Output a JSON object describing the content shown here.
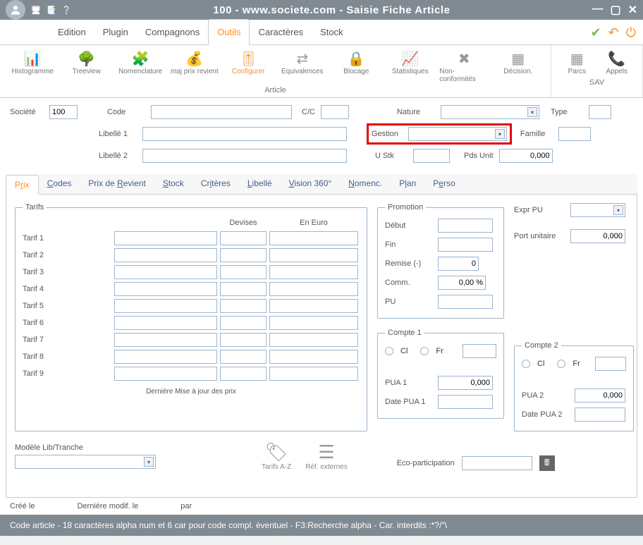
{
  "window": {
    "title": "100 - www.societe.com - Saisie Fiche Article"
  },
  "menubar": {
    "items": [
      "Edition",
      "Plugin",
      "Compagnons",
      "Outils",
      "Caractères",
      "Stock"
    ],
    "activeIndex": 3
  },
  "ribbon": {
    "group_article": {
      "label": "Article",
      "items": [
        {
          "label": "Histogramme"
        },
        {
          "label": "Treeview"
        },
        {
          "label": "Nomenclature"
        },
        {
          "label": "maj prix revient"
        },
        {
          "label": "Configurer",
          "active": true
        },
        {
          "label": "Equivalences"
        },
        {
          "label": "Blocage"
        },
        {
          "label": "Statistiques"
        },
        {
          "label": "Non-conformités"
        },
        {
          "label": "Décision."
        }
      ]
    },
    "group_sav": {
      "label": "SAV",
      "items": [
        {
          "label": "Parcs"
        },
        {
          "label": "Appels"
        }
      ]
    }
  },
  "header_form": {
    "societe_label": "Société",
    "societe_value": "100",
    "code_label": "Code",
    "code_value": "",
    "cc_label": "C/C",
    "cc_value": "",
    "nature_label": "Nature",
    "nature_value": "",
    "type_label": "Type",
    "type_value": "",
    "libelle1_label": "Libellé 1",
    "libelle1_value": "",
    "gestion_label": "Gestion",
    "gestion_value": "",
    "famille_label": "Famille",
    "famille_value": "",
    "libelle2_label": "Libellé 2",
    "libelle2_value": "",
    "ustk_label": "U Stk",
    "ustk_value": "",
    "pdsunit_label": "Pds Unit",
    "pdsunit_value": "0,000"
  },
  "tabs": {
    "items": [
      {
        "pre": "P",
        "u": "r",
        "post": "ix"
      },
      {
        "pre": "",
        "u": "C",
        "post": "odes"
      },
      {
        "pre": "Prix de ",
        "u": "R",
        "post": "evient"
      },
      {
        "pre": "",
        "u": "S",
        "post": "tock"
      },
      {
        "pre": "Cr",
        "u": "i",
        "post": "tères"
      },
      {
        "pre": "",
        "u": "L",
        "post": "ibellé"
      },
      {
        "pre": "",
        "u": "V",
        "post": "ision 360°"
      },
      {
        "pre": "",
        "u": "N",
        "post": "omenc."
      },
      {
        "pre": "P",
        "u": "l",
        "post": "an"
      },
      {
        "pre": "P",
        "u": "e",
        "post": "rso"
      }
    ],
    "activeIndex": 0
  },
  "tarifs": {
    "legend": "Tarifs",
    "col_devises": "Devises",
    "col_euro": "En Euro",
    "rows": [
      {
        "label": "Tarif 1"
      },
      {
        "label": "Tarif 2"
      },
      {
        "label": "Tarif 3"
      },
      {
        "label": "Tarif 4"
      },
      {
        "label": "Tarif 5"
      },
      {
        "label": "Tarif 6"
      },
      {
        "label": "Tarif 7"
      },
      {
        "label": "Tarif 8"
      },
      {
        "label": "Tarif 9"
      }
    ],
    "footer": "Dernière Mise à jour des prix"
  },
  "promotion": {
    "legend": "Promotion",
    "debut_label": "Début",
    "debut_value": "",
    "fin_label": "Fin",
    "fin_value": "",
    "remise_label": "Remise (-)",
    "remise_value": "0",
    "comm_label": "Comm.",
    "comm_value": "0,00 %",
    "pu_label": "PU",
    "pu_value": ""
  },
  "expr": {
    "exprpu_label": "Expr PU",
    "exprpu_value": "",
    "port_label": "Port unitaire",
    "port_value": "0,000"
  },
  "compte1": {
    "legend": "Compte 1",
    "cl_label": "Cl",
    "fr_label": "Fr",
    "value": "",
    "pua_label": "PUA 1",
    "pua_value": "0,000",
    "date_label": "Date PUA 1",
    "date_value": ""
  },
  "compte2": {
    "legend": "Compte 2",
    "cl_label": "Cl",
    "fr_label": "Fr",
    "value": "",
    "pua_label": "PUA 2",
    "pua_value": "0,000",
    "date_label": "Date PUA 2",
    "date_value": ""
  },
  "bottom": {
    "modele_label": "Modèle Lib/Tranche",
    "modele_value": "",
    "tarifs_az": "Tarifs A-Z",
    "ref_ext": "Réf. externes",
    "eco_label": "Eco-participation",
    "eco_value": ""
  },
  "audit": {
    "created_label": "Créé le",
    "modified_label": "Dernière modif. le",
    "by_label": "par"
  },
  "status": "Code article - 18 caractères alpha num et 6 car pour code compl. éventuel - F3:Recherche alpha - Car. interdits :*?/\"\\"
}
